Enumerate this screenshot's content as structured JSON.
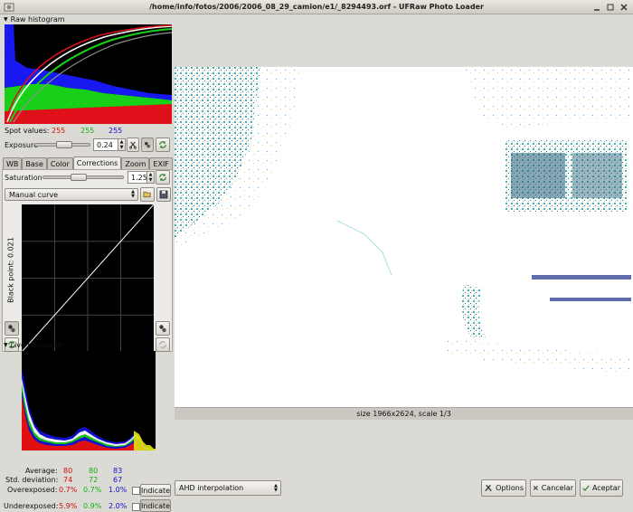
{
  "window": {
    "title": "/home/info/fotos/2006/2006_08_29_camion/e1/_8294493.orf - UFRaw Photo Loader"
  },
  "raw_histogram": {
    "label": "Raw histogram"
  },
  "spot_values": {
    "label": "Spot values:",
    "r": "255",
    "g": "255",
    "b": "255"
  },
  "exposure": {
    "label": "Exposure",
    "value": "0.24",
    "slider_fraction": 0.5
  },
  "tabs": [
    {
      "label": "WB"
    },
    {
      "label": "Base"
    },
    {
      "label": "Color"
    },
    {
      "label": "Corrections"
    },
    {
      "label": "Zoom"
    },
    {
      "label": "EXIF"
    }
  ],
  "saturation": {
    "label": "Saturation",
    "value": "1.25",
    "slider_fraction": 0.56
  },
  "curve": {
    "selected": "Manual curve",
    "black_point_label": "Black point: 0.021"
  },
  "live_histogram": {
    "label": "Live histogram"
  },
  "stats": {
    "average_label": "Average:",
    "average": [
      "80",
      "80",
      "83"
    ],
    "std_label": "Std. deviation:",
    "std": [
      "74",
      "72",
      "67"
    ],
    "over_label": "Overexposed:",
    "over": [
      "0.7%",
      "0.7%",
      "1.0%"
    ],
    "under_label": "Underexposed:",
    "under": [
      "5.9%",
      "0.9%",
      "2.0%"
    ],
    "indicate_label": "Indicate"
  },
  "colors": {
    "red": "#d01010",
    "green": "#10b010",
    "blue": "#1010d0"
  },
  "image": {
    "size_text": "size 1966x2624, scale 1/3"
  },
  "bottom": {
    "interpolation": "AHD interpolation",
    "options_label": "Options",
    "cancel_label": "Cancelar",
    "accept_label": "Aceptar"
  }
}
